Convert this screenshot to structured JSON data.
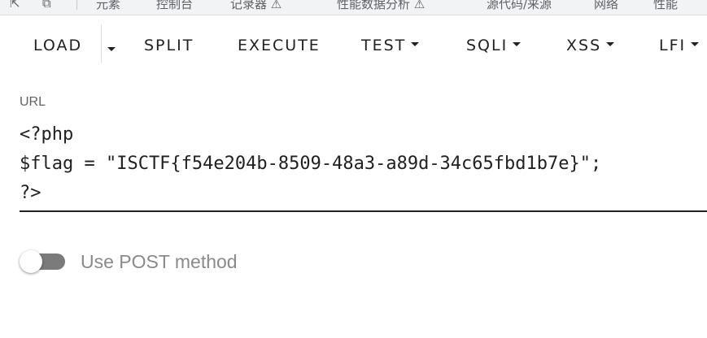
{
  "devtools_tabs": {
    "left_glyphs": [
      "⇱",
      "⧉"
    ],
    "items": [
      "元素",
      "控制台",
      "记录器 ⚠",
      "性能数据分析 ⚠",
      "源代码/来源",
      "网络",
      "性能"
    ]
  },
  "toolbar": {
    "buttons": [
      {
        "label": "LOAD",
        "dropdown": false
      },
      {
        "label": "SPLIT",
        "dropdown": false
      },
      {
        "label": "EXECUTE",
        "dropdown": false
      },
      {
        "label": "TEST",
        "dropdown": true
      },
      {
        "label": "SQLI",
        "dropdown": true
      },
      {
        "label": "XSS",
        "dropdown": true
      },
      {
        "label": "LFI",
        "dropdown": true
      }
    ]
  },
  "url": {
    "label": "URL",
    "value": "<?php\n$flag = \"ISCTF{f54e204b-8509-48a3-a89d-34c65fbd1b7e}\";\n?>"
  },
  "post_method": {
    "label": "Use POST method",
    "enabled": false
  },
  "colors": {
    "toolbar_text": "#212121",
    "switch_track": "#7b7b7b",
    "label_gray": "#8a8a8a"
  }
}
